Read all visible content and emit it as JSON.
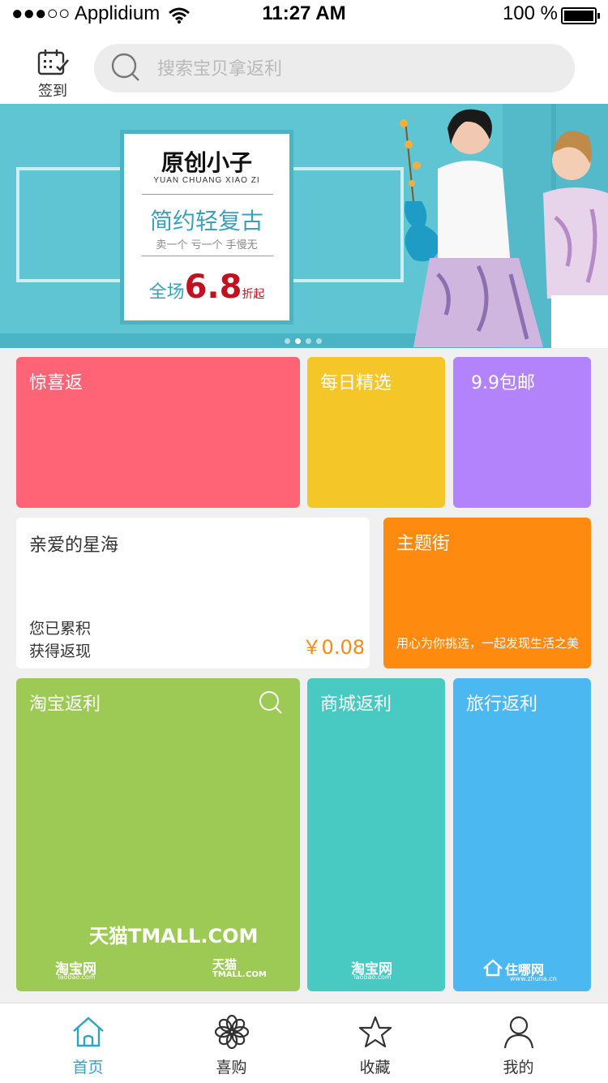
{
  "status_bar": {
    "carrier": "●●●○○ Applidium",
    "time": "11:27 AM",
    "battery": "100 %"
  },
  "header": {
    "signin_label": "签到",
    "search_placeholder": "搜索宝贝拿返利"
  },
  "banner": {
    "brand": "原创小子",
    "brand_en": "YUAN CHUANG XIAO ZI",
    "slogan": "简约轻复古",
    "sub": "卖一个 亏一个 手慢无",
    "promo_prefix": "全场",
    "promo_value": "6.8",
    "promo_suffix": "折起",
    "page_count": 4,
    "active_page": 2
  },
  "tiles": {
    "surprise": "惊喜返",
    "daily": "每日精选",
    "free_ship": "9.9包邮",
    "user_name": "亲爱的星海",
    "accumulated_line1": "您已累积",
    "accumulated_line2": "获得返现",
    "amount": "￥0.08",
    "theme": "主题街",
    "theme_desc": "用心为你挑选，一起发现生活之美",
    "taobao": "淘宝返利",
    "mall": "商城返利",
    "travel": "旅行返利"
  },
  "logos": {
    "tmall": "天猫TMALL.COM",
    "taobao": "淘宝网",
    "taobao_sub": "Taobao.com",
    "tmall_small": "天猫",
    "tmall_small_sub": "TMALL.COM",
    "zhuna": "住哪网",
    "zhuna_sub": "www.zhuna.cn"
  },
  "tabbar": {
    "home": "首页",
    "shop": "喜购",
    "favorites": "收藏",
    "me": "我的"
  },
  "colors": {
    "accent": "#2aa6c0",
    "pink": "#ff6376",
    "yellow": "#f5c628",
    "purple": "#b383fb",
    "orange": "#ff8a10",
    "green": "#9dc955",
    "teal": "#48c9c2",
    "blue": "#4cb8f1"
  }
}
